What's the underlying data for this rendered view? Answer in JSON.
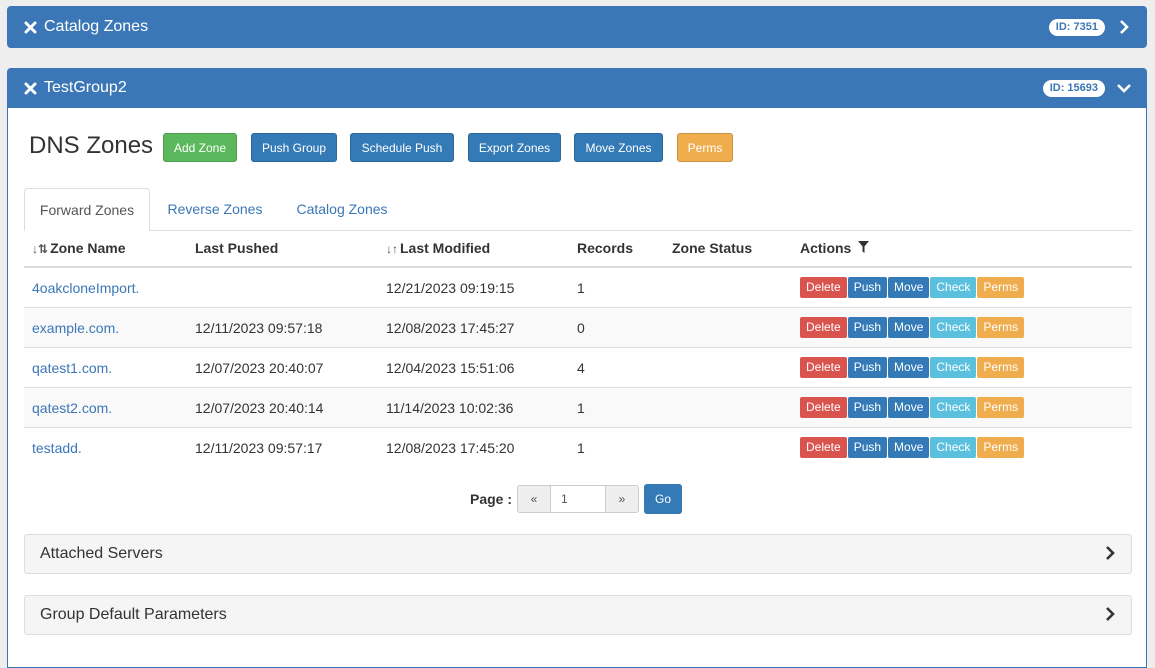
{
  "catalog_panel": {
    "title": "Catalog Zones",
    "id_badge": "ID: 7351"
  },
  "group_panel": {
    "title": "TestGroup2",
    "id_badge": "ID: 15693"
  },
  "page_title": "DNS Zones",
  "toolbar": {
    "add_zone": "Add Zone",
    "push_group": "Push Group",
    "schedule_push": "Schedule Push",
    "export_zones": "Export Zones",
    "move_zones": "Move Zones",
    "perms": "Perms"
  },
  "tabs": [
    "Forward Zones",
    "Reverse Zones",
    "Catalog Zones"
  ],
  "table": {
    "headers": [
      "Zone Name",
      "Last Pushed",
      "Last Modified",
      "Records",
      "Zone Status",
      "Actions"
    ],
    "rows": [
      {
        "name": "4oakcloneImport.",
        "pushed": "",
        "modified": "12/21/2023 09:19:15",
        "records": "1",
        "status": ""
      },
      {
        "name": "example.com.",
        "pushed": "12/11/2023 09:57:18",
        "modified": "12/08/2023 17:45:27",
        "records": "0",
        "status": ""
      },
      {
        "name": "qatest1.com.",
        "pushed": "12/07/2023 20:40:07",
        "modified": "12/04/2023 15:51:06",
        "records": "4",
        "status": ""
      },
      {
        "name": "qatest2.com.",
        "pushed": "12/07/2023 20:40:14",
        "modified": "11/14/2023 10:02:36",
        "records": "1",
        "status": ""
      },
      {
        "name": "testadd.",
        "pushed": "12/11/2023 09:57:17",
        "modified": "12/08/2023 17:45:20",
        "records": "1",
        "status": ""
      }
    ],
    "actions": [
      "Delete",
      "Push",
      "Move",
      "Check",
      "Perms"
    ]
  },
  "pager": {
    "label": "Page :",
    "prev": "«",
    "next": "»",
    "current": "1",
    "go": "Go"
  },
  "sections": [
    "Attached Servers",
    "Group Default Parameters"
  ],
  "colors": {
    "header": "#3b77b7",
    "green": "#5cb85c",
    "blue": "#337ab7",
    "orange": "#f0ad4e",
    "red": "#d9534f",
    "cyan": "#5bc0de"
  }
}
